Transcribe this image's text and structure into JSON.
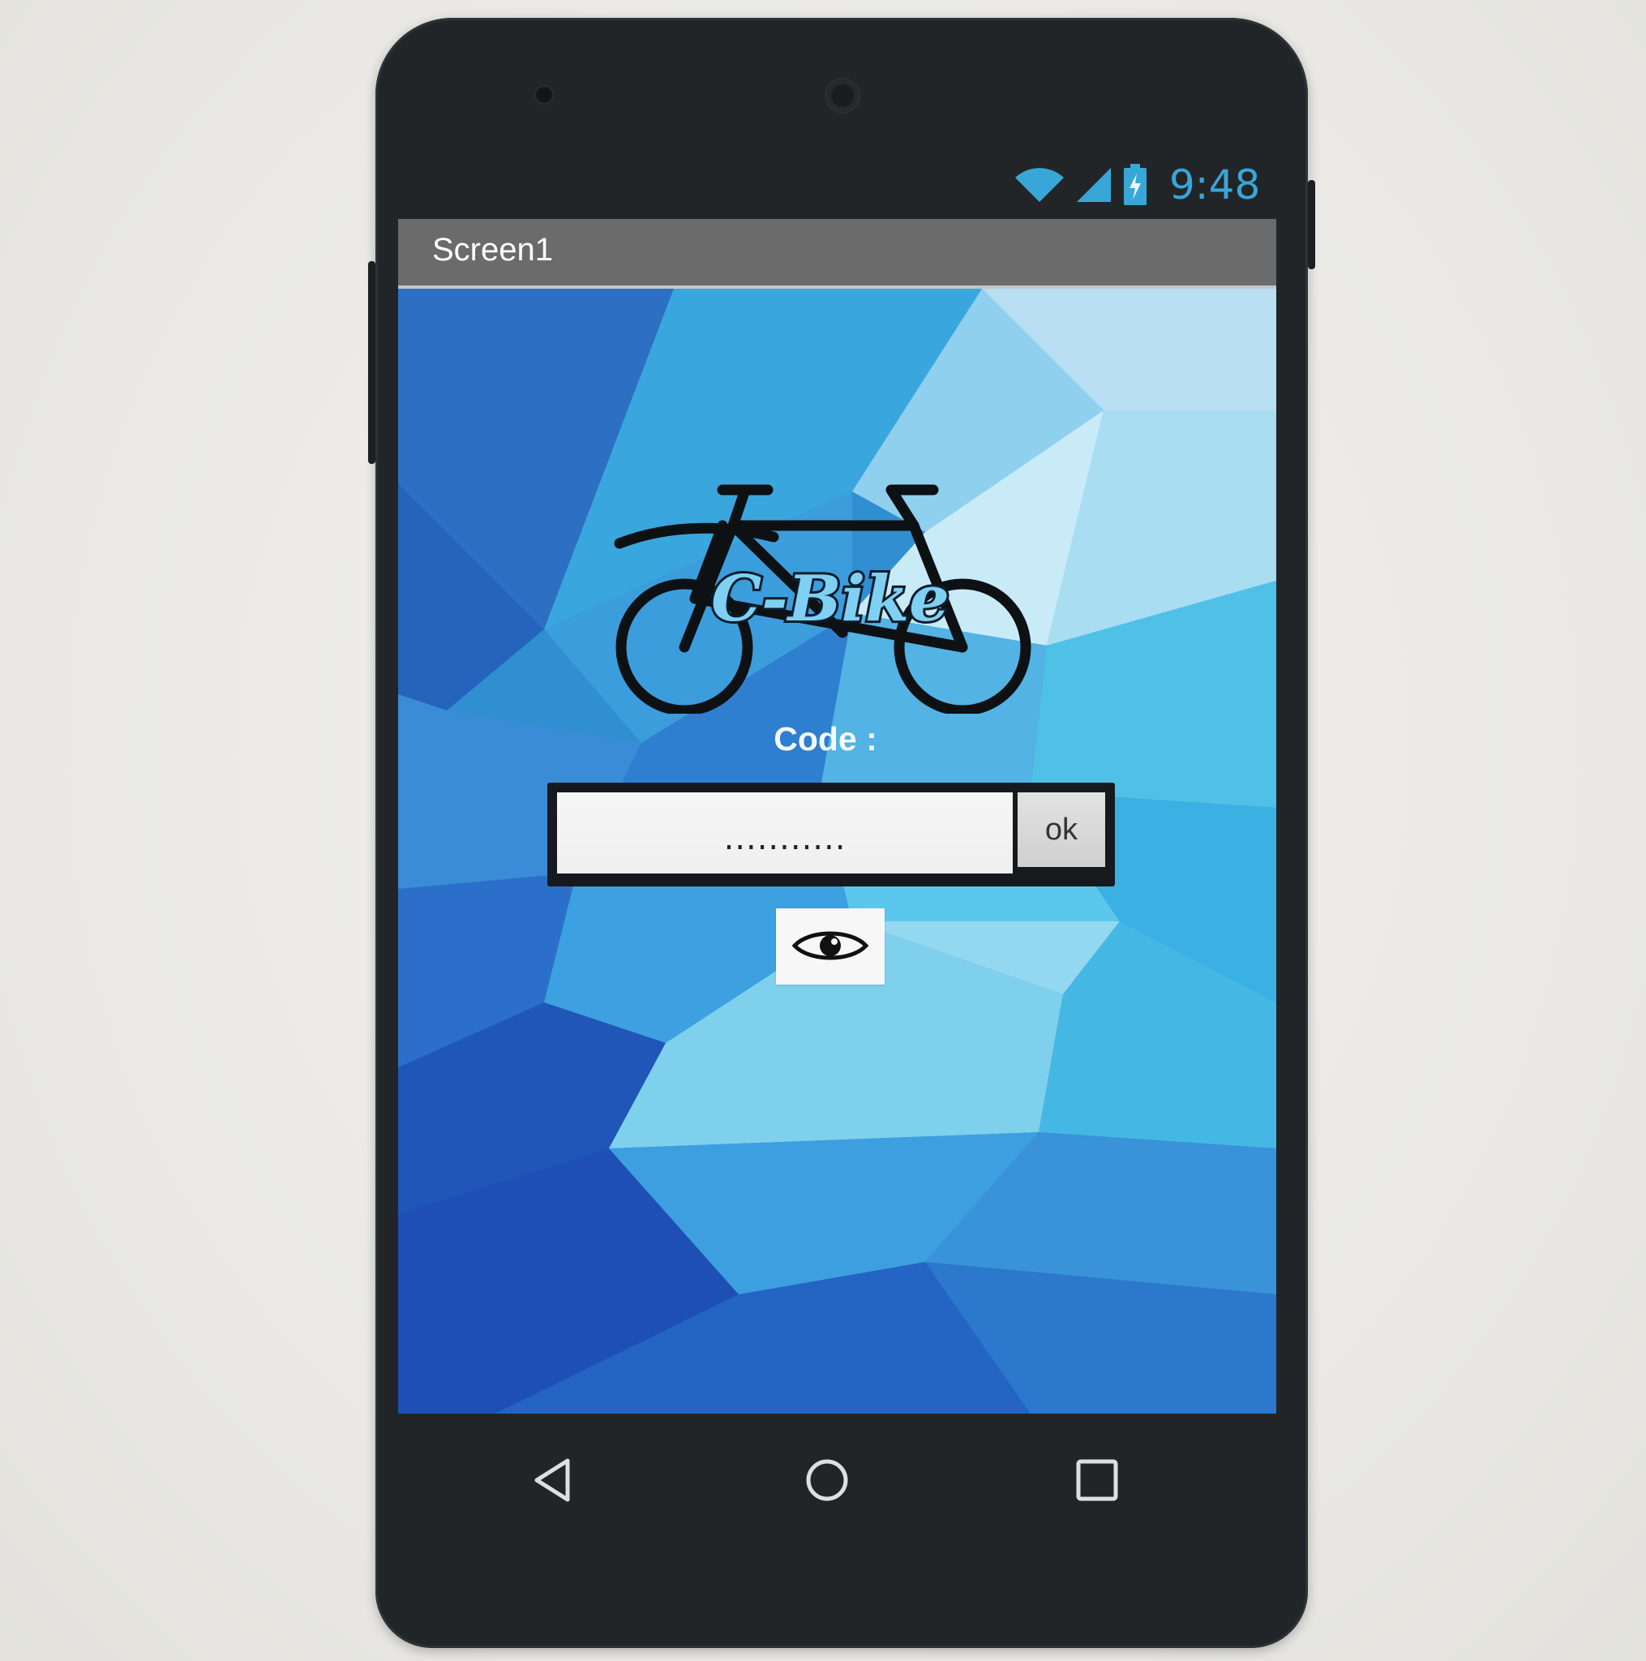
{
  "status_bar": {
    "time": "9:48"
  },
  "app": {
    "title": "Screen1"
  },
  "logo": {
    "brand_text": "C-Bike"
  },
  "form": {
    "code_label": "Code :",
    "code_value": "...........",
    "ok_label": "ok"
  },
  "icons": {
    "wifi": "wifi-icon",
    "signal": "signal-icon",
    "battery": "battery-charging-icon",
    "eye": "eye-icon",
    "back": "back-triangle-icon",
    "home": "home-circle-icon",
    "recents": "recents-square-icon"
  },
  "colors": {
    "status_text": "#39a6d8",
    "titlebar": "#6b6b6b",
    "background_light": "#7fd0ec",
    "background_dark": "#1f55b8"
  }
}
